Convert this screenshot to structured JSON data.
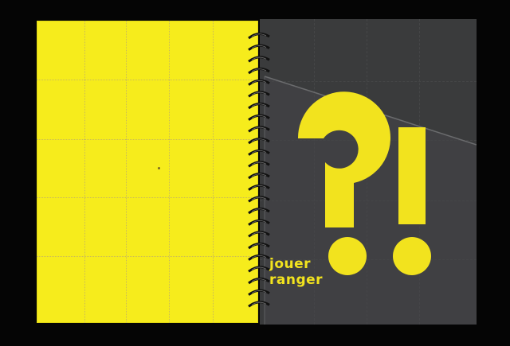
{
  "notebook": {
    "cover_words": [
      "jouer",
      "ranger"
    ],
    "symbols": "?!",
    "colors": {
      "background": "#050505",
      "yellow_page": "#f6ec1c",
      "dark_cover": "#3a3b3c",
      "symbol_yellow": "#f2e31e",
      "spiral": "#111111"
    },
    "left_page_grid": {
      "columns": 5,
      "rows": 6
    },
    "spiral_rings": 24
  }
}
